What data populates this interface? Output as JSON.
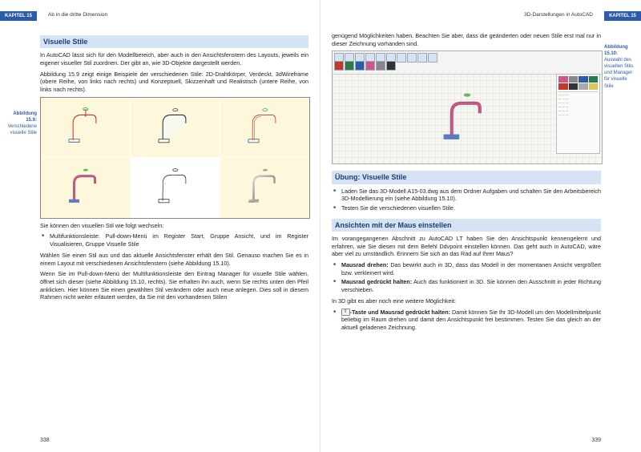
{
  "left": {
    "chapter_tab": "KAPITEL 15",
    "header": "Ab in die dritte Dimension",
    "section1_title": "Visuelle Stile",
    "para1": "In AutoCAD lässt sich für den Modellbereich, aber auch in den Ansichtsfenstern des Layouts, jeweils ein eigener visueller Stil zuordnen. Der gibt an, wie 3D-Objekte dargestellt werden.",
    "para2": "Abbildung 15.9 zeigt einige Beispiele der verschiedenen Stile: 2D-Drahtkörper, Verdeckt, 3dWireframe (obere Reihe, von links nach rechts) und Konzeptuell, Skizzenhaft und Realistisch (untere Reihe, von links nach rechts).",
    "caption1_bold": "Abbildung 15.9:",
    "caption1_text": "Verschiedene visuelle Stile",
    "para3": "Sie können den visuellen Stil wie folgt wechseln:",
    "bullet1": "Multifunktionsleiste: Pull-down-Menü im Register Start, Gruppe Ansicht, und im Register Visualisieren, Gruppe Visuelle Stile",
    "para4": "Wählen Sie einen Stil aus und das aktuelle Ansichtsfenster erhält den Stil. Genauso machen Sie es in einem Layout mit verschiedenen Ansichtsfenstern (siehe Abbildung 15.10).",
    "para5": "Wenn Sie im Pull-down-Menü der Multifunktionsleiste den Eintrag Manager für visuelle Stile wählen, öffnet sich dieser (siehe Abbildung 15.10, rechts). Sie erhalten ihn auch, wenn Sie rechts unten den Pfeil anklicken. Hier können Sie einen gewählten Stil verändern oder auch neue anlegen. Dies soll in diesem Rahmen nicht weiter erläutert werden, da Sie mit den vorhandenen Stilen",
    "page_number": "338"
  },
  "right": {
    "chapter_tab": "KAPITEL 15",
    "header": "3D-Darstellungen in AutoCAD",
    "para1": "genügend Möglichkeiten haben. Beachten Sie aber, dass die geänderten oder neuen Stile erst mal nur in dieser Zeichnung vorhanden sind.",
    "caption1_bold": "Abbildung 15.10:",
    "caption1_text": "Auswahl des visuellen Stils und Manager für visuelle Stile",
    "section2_title": "Übung: Visuelle Stile",
    "ex_bullet1": "Laden Sie das 3D-Modell A15-03.dwg aus dem Ordner Aufgaben und schalten Sie den Arbeitsbereich 3D-Modellierung ein (siehe Abbildung 15.10).",
    "ex_bullet2": "Testen Sie die verschiedenen visuellen Stile.",
    "section3_title": "Ansichten mit der Maus einstellen",
    "para2": "Im vorangegangenen Abschnitt zu AutoCAD LT haben Sie den Ansichtspunkt kennengelernt und erfahren, wie Sie diesen mit dem Befehl Ddvpoint einstellen können. Das geht auch in AutoCAD, wäre aber viel zu umständlich. Erinnern Sie sich an das Rad auf Ihrer Maus?",
    "mouse_bullet1_bold": "Mausrad drehen:",
    "mouse_bullet1": " Das bewirkt auch in 3D, dass das Modell in der momentanen Ansicht vergrößert bzw. verkleinert wird.",
    "mouse_bullet2_bold": "Mausrad gedrückt halten:",
    "mouse_bullet2": " Auch das funktioniert in 3D. Sie können den Ausschnitt in jeder Richtung verschieben.",
    "para3": "In 3D gibt es aber noch eine weitere Möglichkeit:",
    "shift_key": "⇧",
    "mouse_bullet3_bold": "-Taste und Mausrad gedrückt halten:",
    "mouse_bullet3": " Damit können Sie Ihr 3D-Modell um den Modellmittelpunkt beliebig im Raum drehen und damit den Ansichtspunkt frei bestimmen. Testen Sie das gleich an der aktuell geladenen Zeichnung.",
    "page_number": "339"
  }
}
